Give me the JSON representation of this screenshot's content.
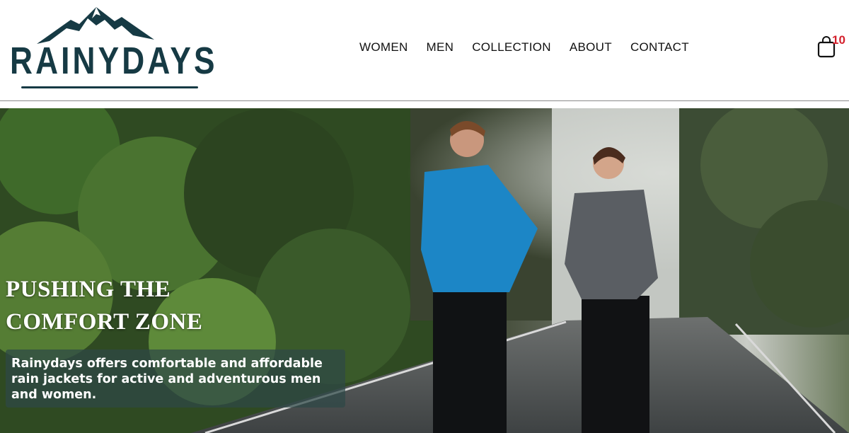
{
  "brand": {
    "name": "RAINYDAYS",
    "color": "#163a44"
  },
  "nav": {
    "items": [
      {
        "label": "WOMEN"
      },
      {
        "label": "MEN"
      },
      {
        "label": "COLLECTION"
      },
      {
        "label": "ABOUT"
      },
      {
        "label": "CONTACT"
      }
    ]
  },
  "cart": {
    "icon": "shopping-bag-icon",
    "count": "10",
    "count_color": "#d4202c"
  },
  "hero": {
    "heading_line1": "PUSHING THE",
    "heading_line2": "COMFORT ZONE",
    "text": "Rainydays offers comfortable and affordable rain jackets for active and adventurous men and women."
  }
}
